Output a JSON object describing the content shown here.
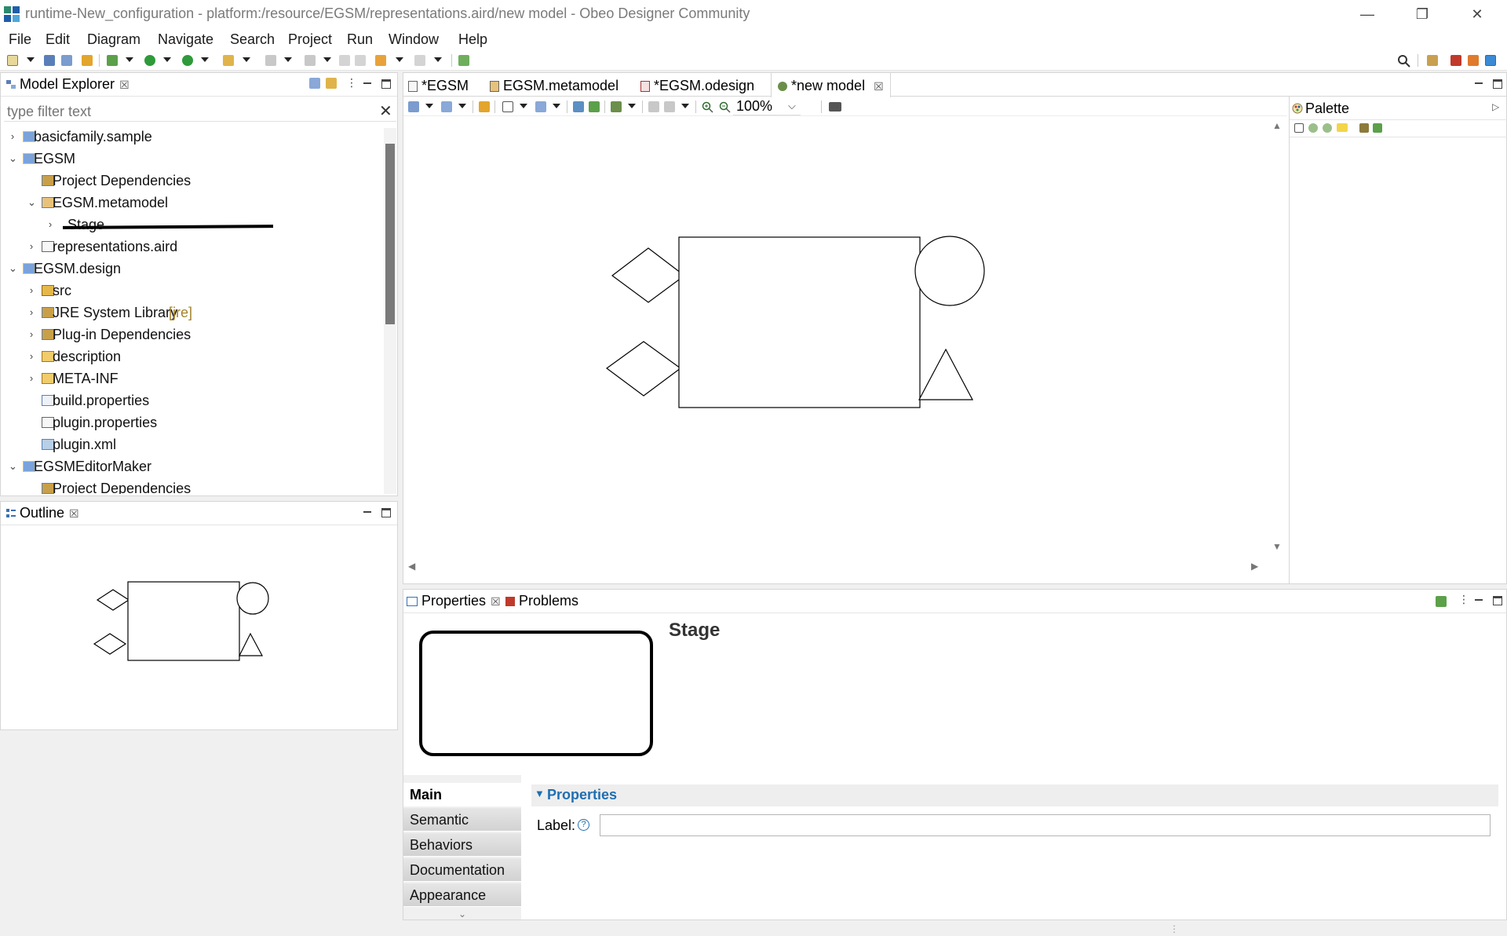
{
  "window": {
    "title": "runtime-New_configuration - platform:/resource/EGSM/representations.aird/new model - Obeo Designer Community",
    "controls": [
      "—",
      "❐",
      "✕"
    ]
  },
  "menu": [
    "File",
    "Edit",
    "Diagram",
    "Navigate",
    "Search",
    "Project",
    "Run",
    "Window",
    "Help"
  ],
  "model_explorer": {
    "tab_label": "Model Explorer",
    "filter_placeholder": "type filter text",
    "tree": [
      {
        "label": "basicfamily.sample",
        "level": 0,
        "arrow": "›",
        "icon": "project-icon"
      },
      {
        "label": "EGSM",
        "level": 0,
        "arrow": "⌄",
        "icon": "project-icon"
      },
      {
        "label": "Project Dependencies",
        "level": 1,
        "arrow": "",
        "icon": "library-icon"
      },
      {
        "label": "EGSM.metamodel",
        "level": 1,
        "arrow": "⌄",
        "icon": "metamodel-icon"
      },
      {
        "label": "Stage",
        "level": 2,
        "arrow": "›",
        "icon": ""
      },
      {
        "label": "representations.aird",
        "level": 1,
        "arrow": "›",
        "icon": "file-icon"
      },
      {
        "label": "EGSM.design",
        "level": 0,
        "arrow": "⌄",
        "icon": "project-icon"
      },
      {
        "label": "src",
        "level": 1,
        "arrow": "›",
        "icon": "package-folder-icon"
      },
      {
        "label": "JRE System Library",
        "tag": "[jre]",
        "level": 1,
        "arrow": "›",
        "icon": "library-icon"
      },
      {
        "label": "Plug-in Dependencies",
        "level": 1,
        "arrow": "›",
        "icon": "library-icon"
      },
      {
        "label": "description",
        "level": 1,
        "arrow": "›",
        "icon": "folder-icon"
      },
      {
        "label": "META-INF",
        "level": 1,
        "arrow": "›",
        "icon": "folder-icon"
      },
      {
        "label": "build.properties",
        "level": 1,
        "arrow": "",
        "icon": "properties-file-icon"
      },
      {
        "label": "plugin.properties",
        "level": 1,
        "arrow": "",
        "icon": "file-icon"
      },
      {
        "label": "plugin.xml",
        "level": 1,
        "arrow": "",
        "icon": "plugin-icon"
      },
      {
        "label": "EGSMEditorMaker",
        "level": 0,
        "arrow": "⌄",
        "icon": "project-icon"
      },
      {
        "label": "Project Dependencies",
        "level": 1,
        "arrow": "",
        "icon": "library-icon"
      }
    ]
  },
  "outline": {
    "tab_label": "Outline"
  },
  "editor": {
    "tabs": [
      {
        "label": "*EGSM",
        "icon": "file-icon",
        "active": false
      },
      {
        "label": "EGSM.metamodel",
        "icon": "metamodel-icon",
        "active": false
      },
      {
        "label": "*EGSM.odesign",
        "icon": "odesign-icon",
        "active": false
      },
      {
        "label": "*new model",
        "icon": "diagram-icon",
        "active": true
      }
    ],
    "zoom": "100%"
  },
  "palette": {
    "label": "Palette"
  },
  "properties_view": {
    "tabs": [
      {
        "label": "Properties",
        "active": true
      },
      {
        "label": "Problems",
        "active": false
      }
    ],
    "preview_title": "Stage",
    "side_tabs": [
      "Main",
      "Semantic",
      "Behaviors",
      "Documentation",
      "Appearance"
    ],
    "section_title": "Properties",
    "label_field": {
      "label": "Label:",
      "help": "?",
      "value": ""
    }
  },
  "colors": {
    "accent_blue": "#1f6fb2",
    "selection": "#cfe3f7"
  }
}
